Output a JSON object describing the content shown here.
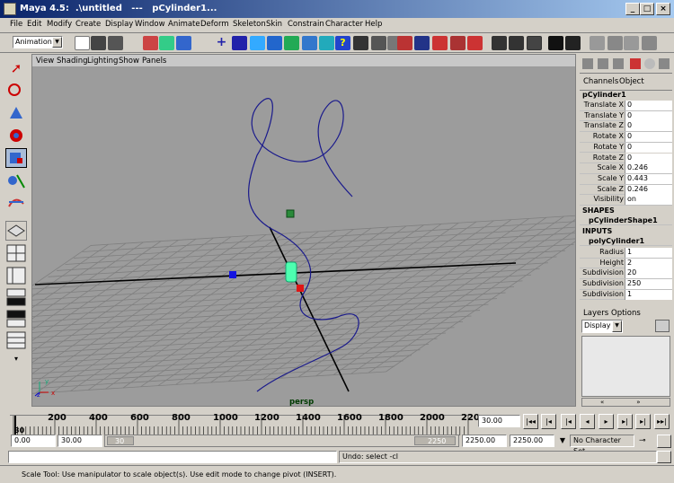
{
  "window": {
    "title": "Maya 4.5:  .\\untitled   ---   pCylinder1..."
  },
  "menus": [
    "File",
    "Edit",
    "Modify",
    "Create",
    "Display",
    "Window",
    "Animate",
    "Deform",
    "Skeleton",
    "Skin",
    "Constrain",
    "Character",
    "Help"
  ],
  "shelf": {
    "mode": "Animation"
  },
  "viewport": {
    "menus": [
      "View",
      "Shading",
      "Lighting",
      "Show",
      "Panels"
    ],
    "camera": "persp",
    "axis_labels": {
      "x": "x",
      "y": "y",
      "z": "z"
    }
  },
  "channel_box": {
    "tabs": [
      "Channels",
      "Object"
    ],
    "object": "pCylinder1",
    "transform": [
      {
        "name": "Translate X",
        "value": "0"
      },
      {
        "name": "Translate Y",
        "value": "0"
      },
      {
        "name": "Translate Z",
        "value": "0"
      },
      {
        "name": "Rotate X",
        "value": "0"
      },
      {
        "name": "Rotate Y",
        "value": "0"
      },
      {
        "name": "Rotate Z",
        "value": "0"
      },
      {
        "name": "Scale X",
        "value": "0.246"
      },
      {
        "name": "Scale Y",
        "value": "0.443"
      },
      {
        "name": "Scale Z",
        "value": "0.246"
      },
      {
        "name": "Visibility",
        "value": "on"
      }
    ],
    "shapes_header": "SHAPES",
    "shape": "pCylinderShape1",
    "inputs_header": "INPUTS",
    "input": "polyCylinder1",
    "input_attrs": [
      {
        "name": "Radius",
        "value": "1"
      },
      {
        "name": "Height",
        "value": "2"
      },
      {
        "name": "Subdivision",
        "value": "20"
      },
      {
        "name": "Subdivision",
        "value": "250"
      },
      {
        "name": "Subdivision",
        "value": "1"
      }
    ]
  },
  "layers": {
    "menus": [
      "Layers",
      "Options"
    ],
    "display": "Display"
  },
  "timeline": {
    "ticks": [
      "200",
      "400",
      "600",
      "800",
      "1000",
      "1200",
      "1400",
      "1600",
      "1800",
      "2000",
      "220"
    ],
    "start_tick": "30",
    "current_time": "30.00",
    "start_time": "0.00",
    "range_start": "30.00",
    "slider_left": "30",
    "slider_right": "2250",
    "range_end": "2250.00",
    "end_time": "2250.00",
    "character_set": "No Character Set"
  },
  "command": {
    "feedback": "Undo: select -cl"
  },
  "help_line": "Scale Tool: Use manipulator to scale object(s). Use edit mode to change pivot (INSERT).",
  "colors": {
    "bg": "#d4d0c8",
    "viewport": "#9c9c9c",
    "curve": "#1a1a8c",
    "selected": "#4dffb0",
    "title": "#0a246a"
  }
}
